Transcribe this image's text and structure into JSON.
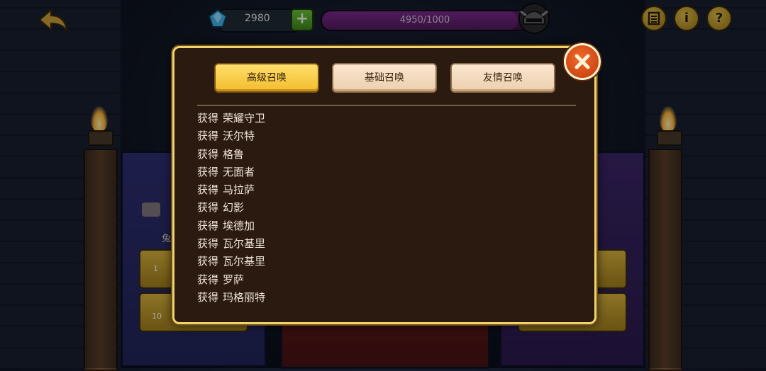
{
  "hud": {
    "gems": "2980",
    "plus_label": "+",
    "energy_text": "4950/1000",
    "energy_fill": 0.95,
    "icons": [
      "list-icon",
      "info-icon",
      "help-icon"
    ],
    "info_label": "i",
    "help_label": "?"
  },
  "background": {
    "free_text": "兔",
    "count_one": "1",
    "count_ten": "10"
  },
  "dialog": {
    "tabs": [
      "高级召唤",
      "基础召唤",
      "友情召唤"
    ],
    "active_tab": 0,
    "log": [
      {
        "verb": "获得",
        "name": "荣耀守卫"
      },
      {
        "verb": "获得",
        "name": "沃尔特"
      },
      {
        "verb": "获得",
        "name": "格鲁"
      },
      {
        "verb": "获得",
        "name": "无面者"
      },
      {
        "verb": "获得",
        "name": "马拉萨"
      },
      {
        "verb": "获得",
        "name": "幻影"
      },
      {
        "verb": "获得",
        "name": "埃德加"
      },
      {
        "verb": "获得",
        "name": "瓦尔基里"
      },
      {
        "verb": "获得",
        "name": "瓦尔基里"
      },
      {
        "verb": "获得",
        "name": "罗萨"
      },
      {
        "verb": "获得",
        "name": "玛格丽特"
      }
    ]
  },
  "colors": {
    "accent_gold": "#f1d36c",
    "dialog_bg": "#2b1a0f",
    "close_orange": "#e0521a"
  }
}
